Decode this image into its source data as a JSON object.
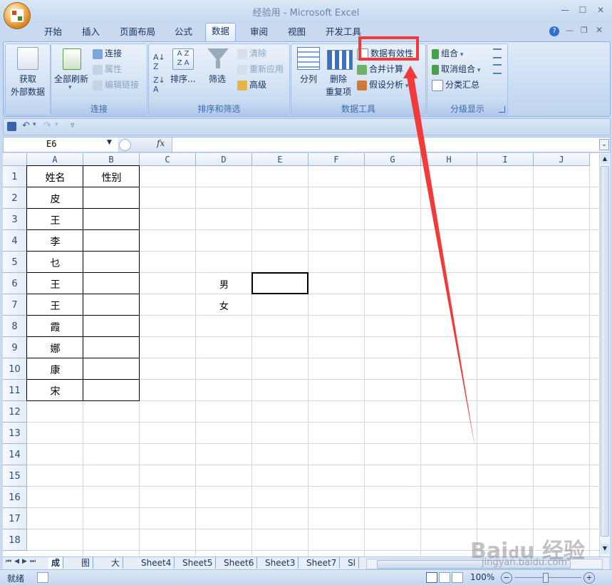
{
  "window": {
    "title": "经验用 - Microsoft Excel"
  },
  "tabs": [
    "开始",
    "插入",
    "页面布局",
    "公式",
    "数据",
    "审阅",
    "视图",
    "开发工具"
  ],
  "active_tab": "数据",
  "ribbon": {
    "get_external": {
      "line1": "获取",
      "line2": "外部数据"
    },
    "connections": {
      "refresh_all": "全部刷新",
      "connect": "连接",
      "properties": "属性",
      "edit_links": "编辑链接",
      "label": "连接"
    },
    "sort_filter": {
      "sort": "排序...",
      "filter": "筛选",
      "clear": "清除",
      "reapply": "重新应用",
      "advanced": "高级",
      "label": "排序和筛选"
    },
    "data_tools": {
      "text_to_columns": "分列",
      "remove_dup_1": "删除",
      "remove_dup_2": "重复项",
      "validation": "数据有效性",
      "consolidate": "合并计算",
      "what_if": "假设分析",
      "label": "数据工具"
    },
    "outline": {
      "group": "组合",
      "ungroup": "取消组合",
      "subtotal": "分类汇总",
      "label": "分级显示"
    }
  },
  "formula_bar": {
    "name_box": "E6",
    "fx": "fx",
    "formula": ""
  },
  "columns": [
    "A",
    "B",
    "C",
    "D",
    "E",
    "F",
    "G",
    "H",
    "I",
    "J"
  ],
  "rows": [
    "1",
    "2",
    "3",
    "4",
    "5",
    "6",
    "7",
    "8",
    "9",
    "10",
    "11",
    "12",
    "13",
    "14",
    "15",
    "16",
    "17",
    "18"
  ],
  "cells": {
    "A1": "姓名",
    "B1": "性别",
    "A2": "皮",
    "A3": "王",
    "A4": "李",
    "A5": "乜",
    "A6": "王",
    "A7": "王",
    "A8": "霞",
    "A9": "娜",
    "A10": "康",
    "A11": "宋",
    "D6": "男",
    "D7": "女"
  },
  "sheets": [
    "成绩",
    "图标",
    "大写",
    "Sheet4",
    "Sheet5",
    "Sheet6",
    "Sheet3",
    "Sheet7",
    "Sl"
  ],
  "active_sheet": "成绩",
  "status": {
    "ready": "就绪",
    "zoom": "100%"
  },
  "watermark": "Baidu经验 jingyan.baidu.com",
  "colors": {
    "annotation_red": "#f23a3a",
    "ribbon_blue": "#c7daf1"
  }
}
